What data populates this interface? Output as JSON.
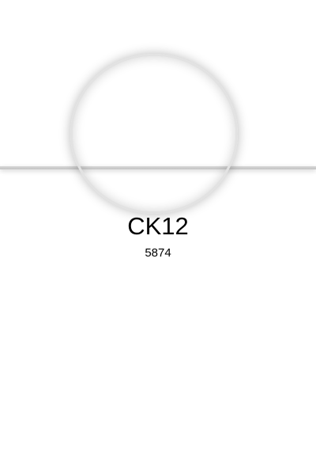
{
  "profile": {
    "name": "CK12",
    "code": "5874"
  },
  "colors": {
    "background": "#ffffff",
    "divider": "#c4c4c4",
    "ring": "#e2e2e2",
    "text": "#000000"
  }
}
